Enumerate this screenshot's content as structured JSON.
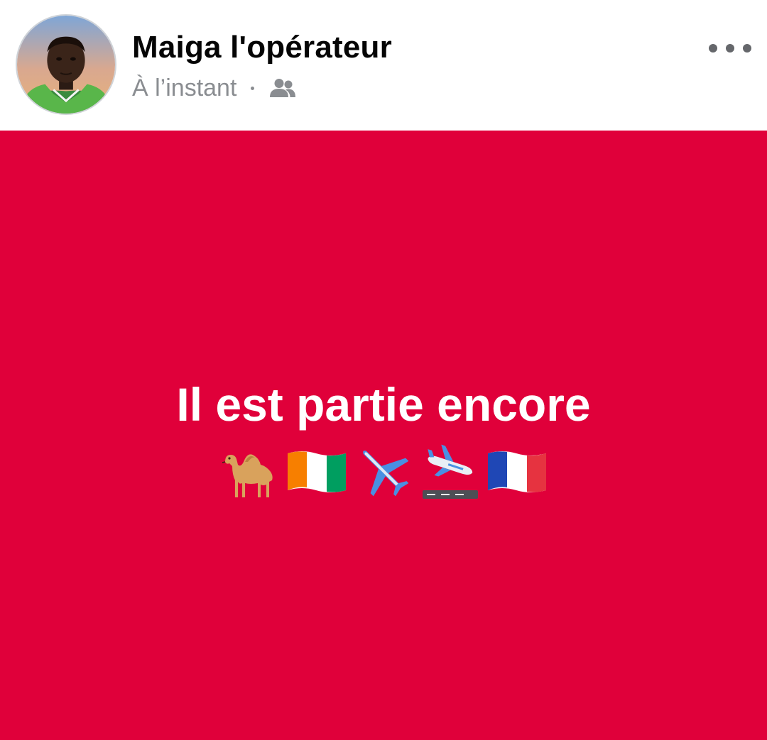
{
  "post": {
    "author_name": "Maiga l'opérateur",
    "timestamp": "À l’instant",
    "separator": "·",
    "audience_icon": "friends-icon",
    "menu_icon": "more-options-icon",
    "body_text": "Il est partie encore",
    "background_color": "#e0003a",
    "text_color": "#ffffff",
    "emojis": [
      {
        "name": "camel",
        "glyph": "🐪"
      },
      {
        "name": "flag-cote-divoire",
        "glyph": "🇨🇮"
      },
      {
        "name": "airplane",
        "glyph": "✈️"
      },
      {
        "name": "airplane-arrival",
        "glyph": "🛬"
      },
      {
        "name": "flag-france",
        "glyph": "🇫🇷"
      }
    ]
  }
}
